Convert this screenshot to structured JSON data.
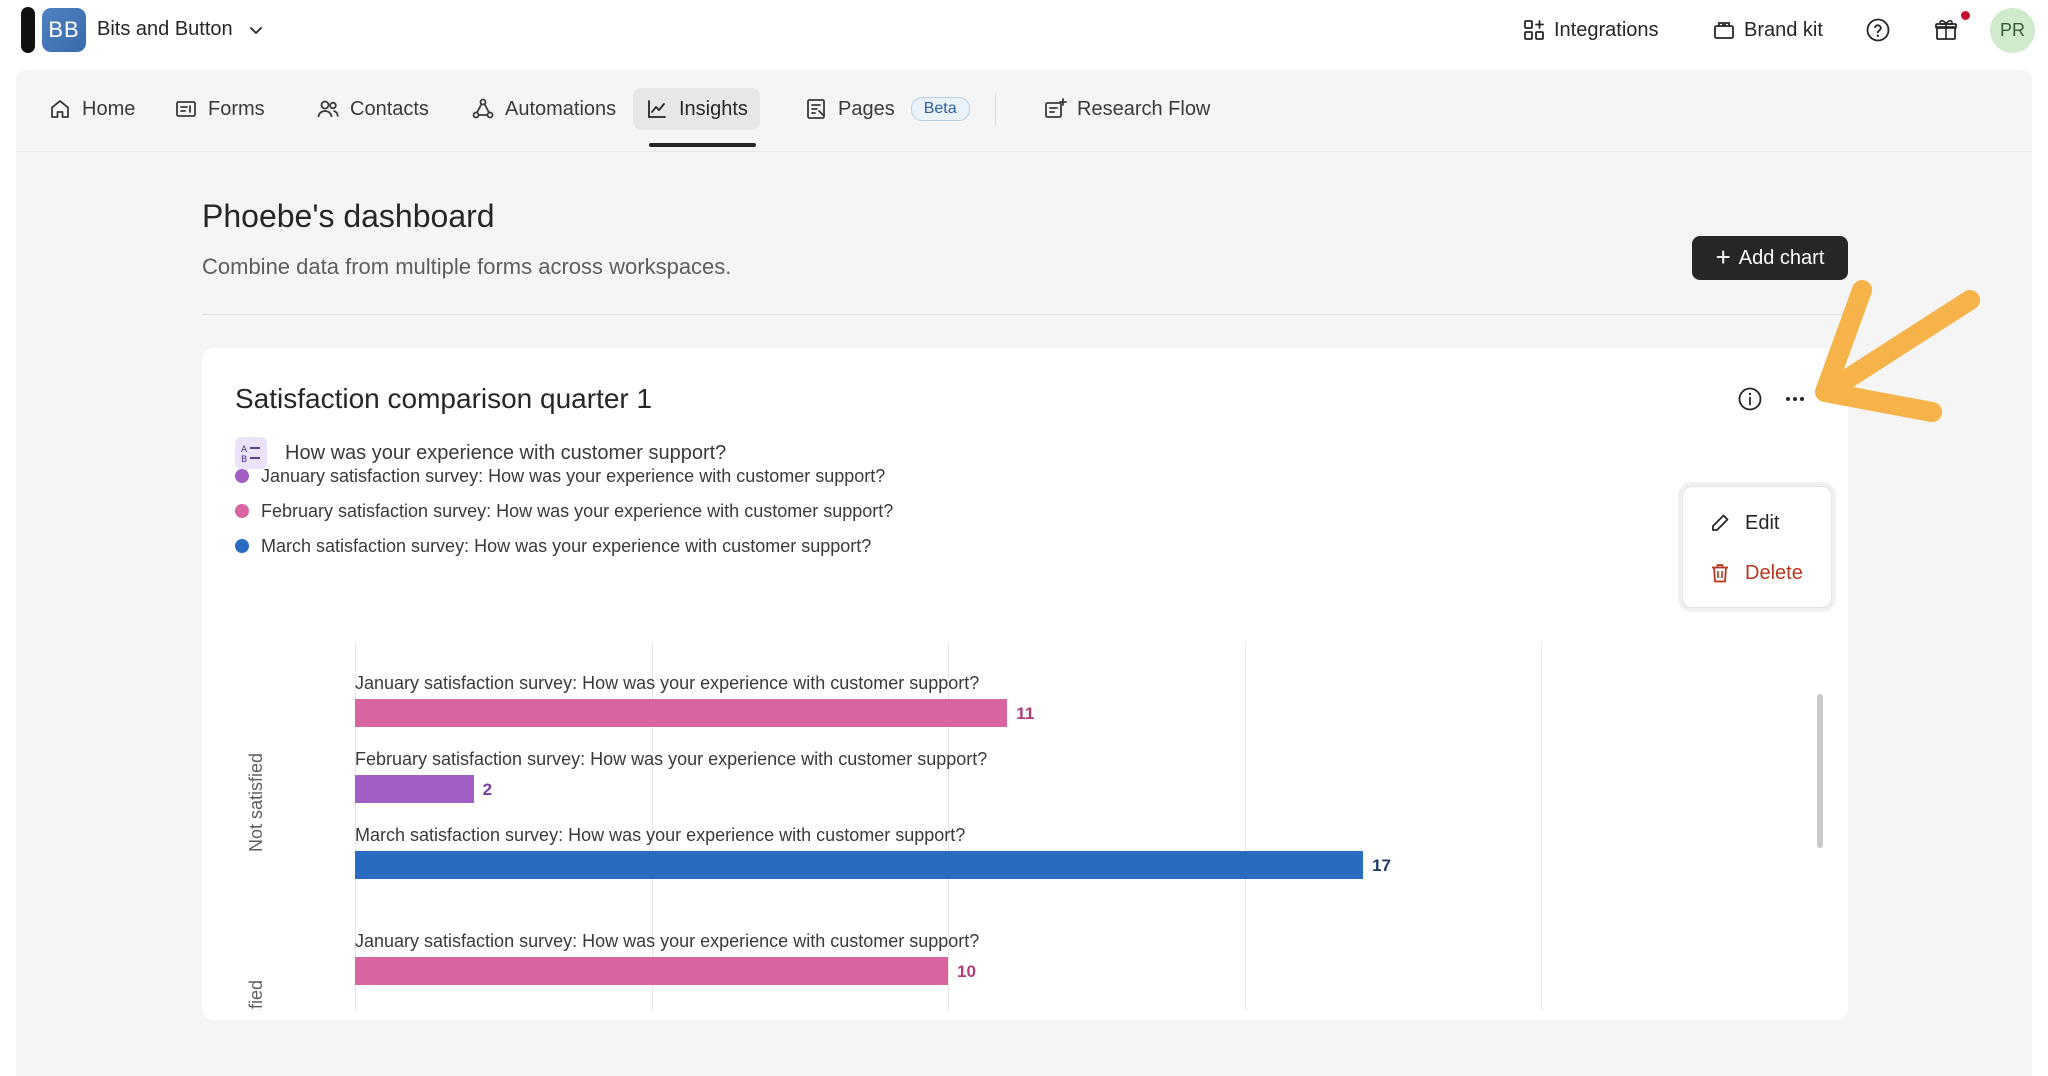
{
  "workspace": {
    "initials": "BB",
    "name": "Bits and Button"
  },
  "topbar": {
    "integrations": "Integrations",
    "brand_kit": "Brand kit",
    "user_initials": "PR"
  },
  "nav": {
    "home": "Home",
    "forms": "Forms",
    "contacts": "Contacts",
    "automations": "Automations",
    "insights": "Insights",
    "pages": "Pages",
    "pages_badge": "Beta",
    "research_flow": "Research Flow"
  },
  "page": {
    "title": "Phoebe's dashboard",
    "subtitle": "Combine data from multiple forms across workspaces.",
    "add_chart": "Add chart"
  },
  "card": {
    "title": "Satisfaction comparison quarter 1",
    "question": "How was your experience with customer support?",
    "legend": [
      {
        "label": "January satisfaction survey: How was your experience with customer support?",
        "color": "#a15ec4"
      },
      {
        "label": "February satisfaction survey: How was your experience with customer support?",
        "color": "#d965a0"
      },
      {
        "label": "March satisfaction survey: How was your experience with customer support?",
        "color": "#2a6bc2"
      }
    ]
  },
  "menu": {
    "edit": "Edit",
    "delete": "Delete"
  },
  "chart_data": {
    "type": "bar",
    "orientation": "horizontal",
    "xlim": [
      0,
      20
    ],
    "groups": [
      {
        "category": "Not satisfied",
        "bars": [
          {
            "label": "January satisfaction survey: How was your experience with customer support?",
            "value": 11,
            "color": "#d965a0",
            "value_color": "#b23a7a"
          },
          {
            "label": "February satisfaction survey: How was your experience with customer support?",
            "value": 2,
            "color": "#a15ec4",
            "value_color": "#7a3c9e"
          },
          {
            "label": "March satisfaction survey: How was your experience with customer support?",
            "value": 17,
            "color": "#2a6bc2",
            "value_color": "#1f3b66"
          }
        ]
      },
      {
        "category": "Satisfied",
        "bars": [
          {
            "label": "January satisfaction survey: How was your experience with customer support?",
            "value": 10,
            "color": "#d965a0",
            "value_color": "#b23a7a"
          }
        ]
      }
    ]
  }
}
